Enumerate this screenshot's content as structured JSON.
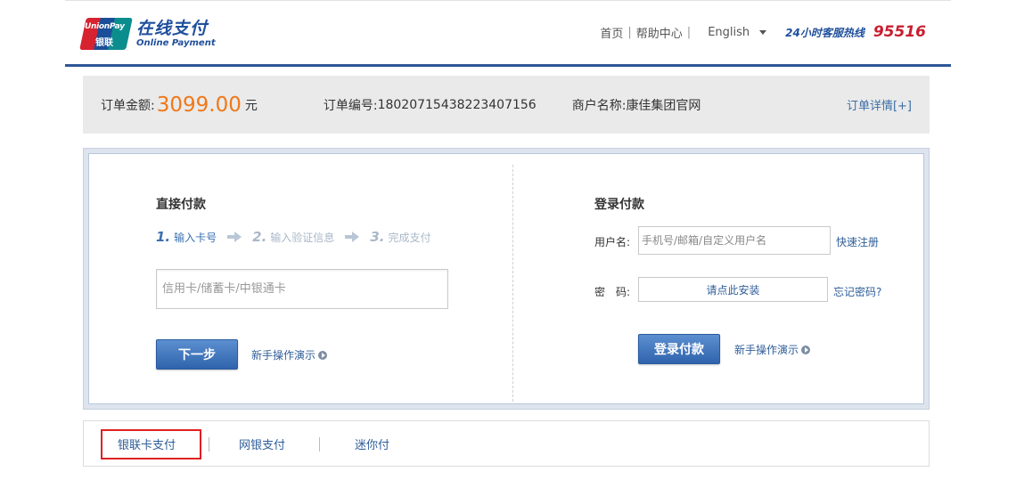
{
  "header": {
    "logo": {
      "brand_en": "UnionPay",
      "brand_cn": "银联",
      "title_cn": "在线支付",
      "title_en": "Online Payment"
    },
    "nav": {
      "home": "首页",
      "help": "帮助中心",
      "separator": "|",
      "language": "English",
      "hotline_label": "24小时客服热线",
      "hotline_number": "95516"
    }
  },
  "order": {
    "amount_label": "订单金额:",
    "amount": "3099.00",
    "currency": "元",
    "order_no_label": "订单编号:",
    "order_no": "18020715438223407156",
    "merchant_label": "商户名称:",
    "merchant": "康佳集团官网",
    "detail_link": "订单详情[+]"
  },
  "direct_pay": {
    "title": "直接付款",
    "steps": [
      {
        "num": "1.",
        "label": "输入卡号"
      },
      {
        "num": "2.",
        "label": "输入验证信息"
      },
      {
        "num": "3.",
        "label": "完成支付"
      }
    ],
    "card_placeholder": "信用卡/储蓄卡/中银通卡",
    "next_button": "下一步",
    "demo_link": "新手操作演示"
  },
  "login_pay": {
    "title": "登录付款",
    "username_label": "用户名:",
    "username_placeholder": "手机号/邮箱/自定义用户名",
    "register_link": "快速注册",
    "password_label": "密　码:",
    "password_install": "请点此安装",
    "forgot_link": "忘记密码?",
    "login_button": "登录付款",
    "demo_link": "新手操作演示"
  },
  "tabs": [
    {
      "label": "银联卡支付",
      "selected": true
    },
    {
      "label": "网银支付",
      "selected": false
    },
    {
      "label": "迷你付",
      "selected": false
    }
  ],
  "colors": {
    "brand_blue": "#2c5696",
    "amount_orange": "#f07818",
    "hotline_red": "#c81e2f",
    "highlight_red": "#e02020"
  }
}
